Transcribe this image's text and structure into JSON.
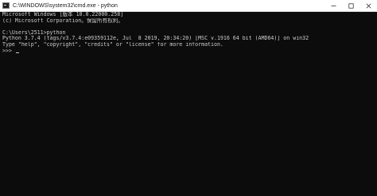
{
  "titlebar": {
    "title": "C:\\WINDOWS\\system32\\cmd.exe - python",
    "minimize_icon": "minimize-icon",
    "maximize_icon": "maximize-icon",
    "close_icon": "close-icon"
  },
  "console": {
    "lines": [
      "Microsoft Windows [版本 10.0.22000.258]",
      "(c) Microsoft Corporation。保留所有权利。",
      "",
      "C:\\Users\\2511>python",
      "Python 3.7.4 (tags/v3.7.4:e09359112e, Jul  8 2019, 20:34:20) [MSC v.1916 64 bit (AMD64)] on win32",
      "Type \"help\", \"copyright\", \"credits\" or \"license\" for more information."
    ],
    "prompt": ">>> "
  },
  "colors": {
    "background": "#0c0c0c",
    "text": "#cccccc",
    "titlebar": "#ffffff"
  }
}
